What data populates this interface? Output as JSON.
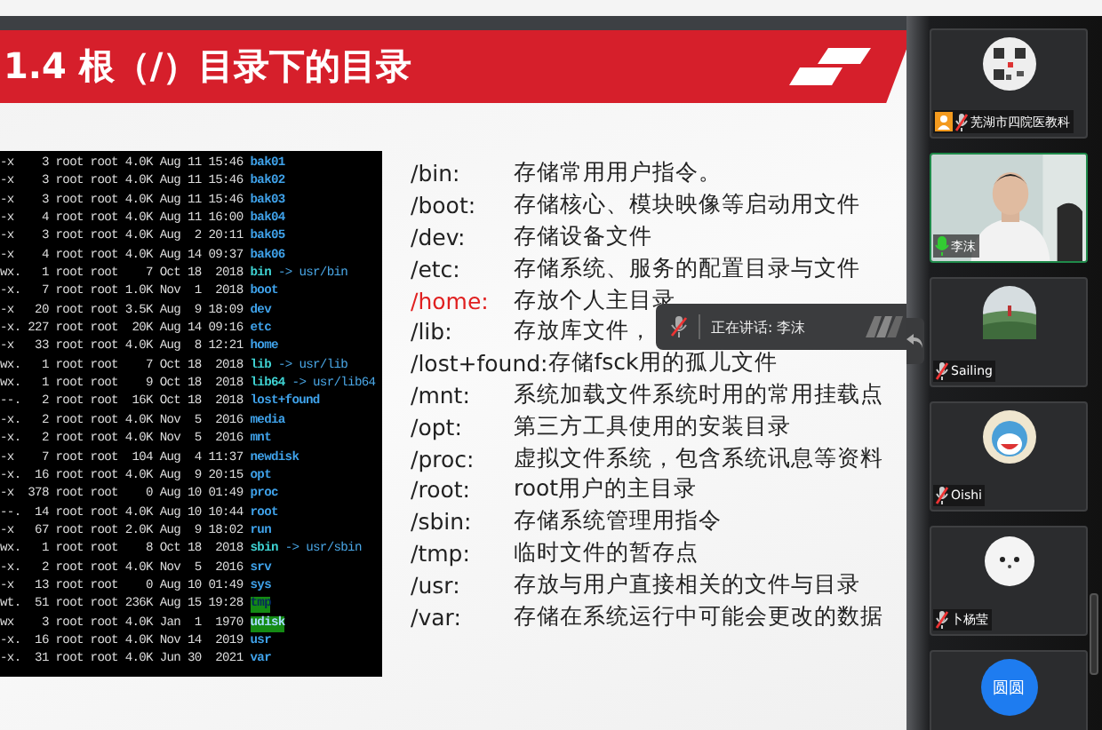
{
  "slide": {
    "title": "1.4 根（/）目录下的目录",
    "listing": [
      {
        "info": "-x    3 root root 4.0K Aug 11 15:46",
        "name": "bak01",
        "kind": "dir"
      },
      {
        "info": "-x    3 root root 4.0K Aug 11 15:46",
        "name": "bak02",
        "kind": "dir"
      },
      {
        "info": "-x    3 root root 4.0K Aug 11 15:46",
        "name": "bak03",
        "kind": "dir"
      },
      {
        "info": "-x    4 root root 4.0K Aug 11 16:00",
        "name": "bak04",
        "kind": "dir"
      },
      {
        "info": "-x    3 root root 4.0K Aug  2 20:11",
        "name": "bak05",
        "kind": "dir"
      },
      {
        "info": "-x    4 root root 4.0K Aug 14 09:37",
        "name": "bak06",
        "kind": "dir"
      },
      {
        "info": "wx.   1 root root    7 Oct 18  2018",
        "name": "bin",
        "kind": "link",
        "target": "-> usr/bin"
      },
      {
        "info": "-x.   7 root root 1.0K Nov  1  2018",
        "name": "boot",
        "kind": "dir"
      },
      {
        "info": "-x   20 root root 3.5K Aug  9 18:09",
        "name": "dev",
        "kind": "dir"
      },
      {
        "info": "-x. 227 root root  20K Aug 14 09:16",
        "name": "etc",
        "kind": "dir"
      },
      {
        "info": "-x   33 root root 4.0K Aug  8 12:21",
        "name": "home",
        "kind": "dir"
      },
      {
        "info": "wx.   1 root root    7 Oct 18  2018",
        "name": "lib",
        "kind": "link",
        "target": "-> usr/lib"
      },
      {
        "info": "wx.   1 root root    9 Oct 18  2018",
        "name": "lib64",
        "kind": "link",
        "target": "-> usr/lib64"
      },
      {
        "info": "--.   2 root root  16K Oct 18  2018",
        "name": "lost+found",
        "kind": "dir"
      },
      {
        "info": "-x.   2 root root 4.0K Nov  5  2016",
        "name": "media",
        "kind": "dir"
      },
      {
        "info": "-x.   2 root root 4.0K Nov  5  2016",
        "name": "mnt",
        "kind": "dir"
      },
      {
        "info": "-x    7 root root  104 Aug  4 11:37",
        "name": "newdisk",
        "kind": "dir"
      },
      {
        "info": "-x.  16 root root 4.0K Aug  9 20:15",
        "name": "opt",
        "kind": "dir"
      },
      {
        "info": "-x  378 root root    0 Aug 10 01:49",
        "name": "proc",
        "kind": "dir"
      },
      {
        "info": "--.  14 root root 4.0K Aug 10 10:44",
        "name": "root",
        "kind": "dir"
      },
      {
        "info": "-x   67 root root 2.0K Aug  9 18:02",
        "name": "run",
        "kind": "dir"
      },
      {
        "info": "wx.   1 root root    8 Oct 18  2018",
        "name": "sbin",
        "kind": "link",
        "target": "-> usr/sbin"
      },
      {
        "info": "-x.   2 root root 4.0K Nov  5  2016",
        "name": "srv",
        "kind": "dir"
      },
      {
        "info": "-x   13 root root    0 Aug 10 01:49",
        "name": "sys",
        "kind": "dir"
      },
      {
        "info": "wt.  51 root root 236K Aug 15 19:28",
        "name": "tmp",
        "kind": "sticky"
      },
      {
        "info": "wx    3 root root 4.0K Jan  1  1970",
        "name": "udisk",
        "kind": "writable"
      },
      {
        "info": "-x.  16 root root 4.0K Nov 14  2019",
        "name": "usr",
        "kind": "dir"
      },
      {
        "info": "-x.  31 root root 4.0K Jun 30  2021",
        "name": "var",
        "kind": "dir"
      }
    ],
    "entries": [
      {
        "path": "/bin:",
        "description": "存储常用用户指令。",
        "highlight": false
      },
      {
        "path": "/boot:",
        "description": "存储核心、模块映像等启动用文件",
        "highlight": false
      },
      {
        "path": "/dev:",
        "description": "存储设备文件",
        "highlight": false
      },
      {
        "path": "/etc:",
        "description": "存储系统、服务的配置目录与文件",
        "highlight": false
      },
      {
        "path": "/home:",
        "description": "存放个人主目录",
        "highlight": true
      },
      {
        "path": "/lib:",
        "description": "存放库文件，",
        "highlight": false
      },
      {
        "path": "/lost+found:",
        "description": "存储fsck用的孤儿文件",
        "highlight": false
      },
      {
        "path": "/mnt:",
        "description": "系统加载文件系统时用的常用挂载点",
        "highlight": false
      },
      {
        "path": "/opt:",
        "description": "第三方工具使用的安装目录",
        "highlight": false
      },
      {
        "path": "/proc:",
        "description": "虚拟文件系统，包含系统讯息等资料",
        "highlight": false
      },
      {
        "path": "/root:",
        "description": "root用户的主目录",
        "highlight": false
      },
      {
        "path": "/sbin:",
        "description": "存储系统管理用指令",
        "highlight": false
      },
      {
        "path": "/tmp:",
        "description": "临时文件的暂存点",
        "highlight": false
      },
      {
        "path": "/usr:",
        "description": "存放与用户直接相关的文件与目录",
        "highlight": false
      },
      {
        "path": "/var:",
        "description": "存储在系统运行中可能会更改的数据",
        "highlight": false
      }
    ]
  },
  "speaking_tip": {
    "text": "正在讲话: 李沫"
  },
  "participants": [
    {
      "name": "芜湖市四院医教科",
      "host": true,
      "muted": true,
      "selected": false
    },
    {
      "name": "李沫",
      "host": false,
      "muted": false,
      "selected": true
    },
    {
      "name": "Sailing",
      "host": false,
      "muted": true,
      "selected": false
    },
    {
      "name": "Oishi",
      "host": false,
      "muted": true,
      "selected": false
    },
    {
      "name": "卜杨莹",
      "host": false,
      "muted": true,
      "selected": false
    },
    {
      "avatar_text": "圆圆",
      "selected": false
    }
  ]
}
